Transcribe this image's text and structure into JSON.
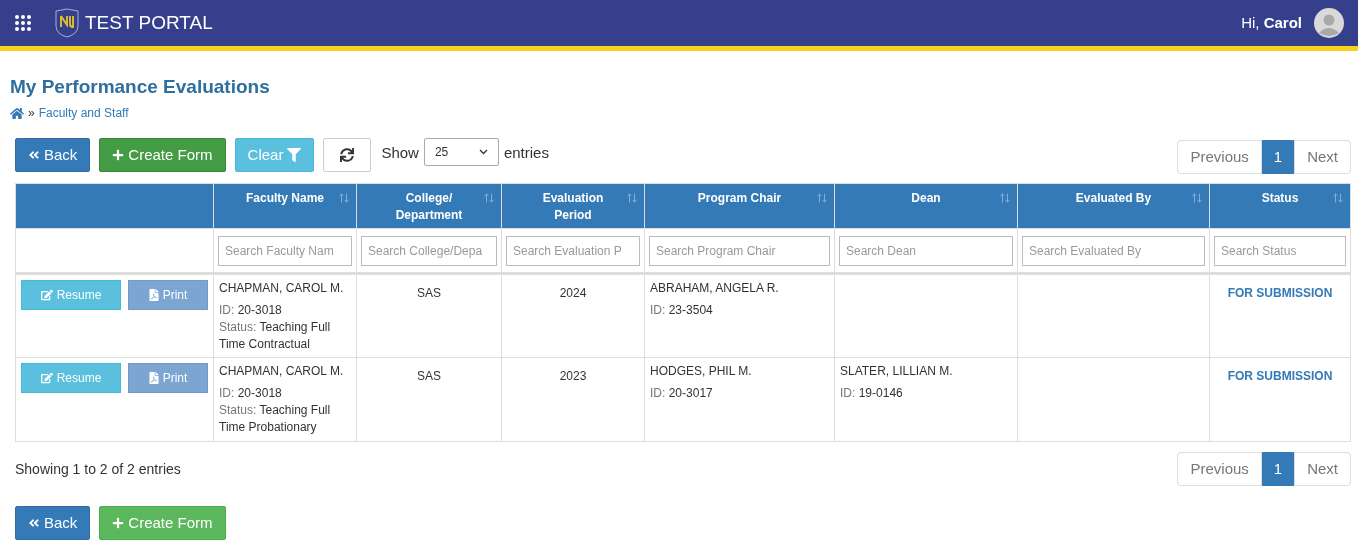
{
  "header": {
    "title": "TEST PORTAL",
    "greeting": "Hi,",
    "user_name": "Carol"
  },
  "page": {
    "title": "My Performance Evaluations",
    "breadcrumb": [
      {
        "separator": "»",
        "label": "Faculty and Staff"
      }
    ]
  },
  "toolbar": {
    "buttons": [
      {
        "kind": "back",
        "label": "Back",
        "hovered": false
      },
      {
        "kind": "create",
        "label": "Create Form",
        "hovered": true
      },
      {
        "kind": "clear",
        "label": "Clear",
        "hovered": false
      },
      {
        "kind": "refresh",
        "hovered": false
      }
    ],
    "show_label": "Show",
    "entries_value": "25",
    "entries_label": "entries"
  },
  "pagination_top": {
    "previous": "Previous",
    "pages": [
      {
        "label": "1",
        "selected": true
      }
    ],
    "next": "Next"
  },
  "table": {
    "columns": [
      "",
      "Faculty Name",
      "College/ Department",
      "Evaluation Period",
      "Program Chair",
      "Dean",
      "Evaluated By",
      "Status"
    ],
    "filters": [
      {
        "placeholder": "Search Faculty Nam"
      },
      {
        "placeholder": "Search College/Depa"
      },
      {
        "placeholder": "Search Evaluation P"
      },
      {
        "placeholder": "Search Program Chair"
      },
      {
        "placeholder": "Search Dean"
      },
      {
        "placeholder": "Search Evaluated By"
      },
      {
        "placeholder": "Search Status"
      }
    ],
    "rows": [
      {
        "actions": [
          {
            "kind": "resume",
            "label": "Resume"
          },
          {
            "kind": "print",
            "label": "Print"
          }
        ],
        "faculty": {
          "name": "CHAPMAN, CAROL M.",
          "id_label": "ID:",
          "id": "20-3018",
          "status_label": "Status:",
          "status": "Teaching Full Time Contractual"
        },
        "college": "SAS",
        "period": "2024",
        "program_chair": {
          "name": "ABRAHAM, ANGELA R.",
          "id_label": "ID:",
          "id": "23-3504"
        },
        "status": "FOR SUBMISSION"
      },
      {
        "actions": [
          {
            "kind": "resume",
            "label": "Resume"
          },
          {
            "kind": "print",
            "label": "Print"
          }
        ],
        "faculty": {
          "name": "CHAPMAN, CAROL M.",
          "id_label": "ID:",
          "id": "20-3018",
          "status_label": "Status:",
          "status": "Teaching Full Time Probationary"
        },
        "college": "SAS",
        "period": "2023",
        "program_chair": {
          "name": "HODGES, PHIL M.",
          "id_label": "ID:",
          "id": "20-3017"
        },
        "dean": {
          "name": "SLATER, LILLIAN M.",
          "id_label": "ID:",
          "id": "19-0146"
        },
        "status": "FOR SUBMISSION"
      }
    ]
  },
  "footer_info": "Showing 1 to 2 of 2 entries",
  "pagination_bottom": {
    "previous": "Previous",
    "pages": [
      {
        "label": "1",
        "selected": true
      }
    ],
    "next": "Next"
  },
  "bottom_buttons": [
    {
      "kind": "back",
      "label": "Back",
      "hovered": false
    },
    {
      "kind": "create",
      "label": "Create Form",
      "hovered": false
    }
  ]
}
